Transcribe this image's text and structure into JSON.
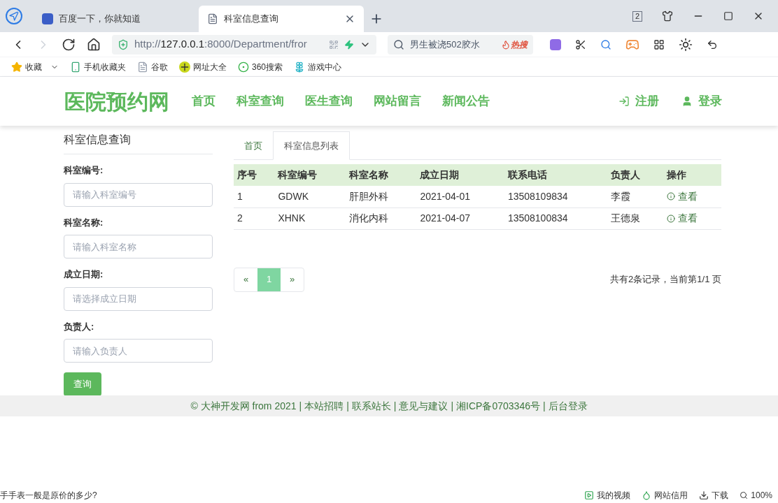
{
  "browser": {
    "tabs": [
      {
        "label": "百度一下，你就知道",
        "selected": false,
        "kind": "baidu"
      },
      {
        "label": "科室信息查询",
        "selected": true,
        "kind": "page"
      }
    ],
    "tab_count": "2",
    "address": {
      "host": "127.0.0.1",
      "prefix": "http://",
      "suffix": ":8000/Department/fror"
    },
    "search": {
      "value": "男生被浇502胶水",
      "hot": "热搜"
    },
    "bookmarks": [
      {
        "label": "收藏",
        "kind": "star"
      },
      {
        "label": "手机收藏夹",
        "kind": "phone"
      },
      {
        "label": "谷歌",
        "kind": "doc"
      },
      {
        "label": "网址大全",
        "kind": "plus"
      },
      {
        "label": "360搜索",
        "kind": "ring"
      },
      {
        "label": "游戏中心",
        "kind": "cross"
      }
    ]
  },
  "site": {
    "logo": "医院预约网",
    "nav": [
      "首页",
      "科室查询",
      "医生查询",
      "网站留言",
      "新闻公告"
    ],
    "auth": [
      {
        "label": "注册",
        "kind": "signin"
      },
      {
        "label": "登录",
        "kind": "user"
      }
    ]
  },
  "sidebar": {
    "title": "科室信息查询",
    "fields": [
      {
        "label": "科室编号:",
        "placeholder": "请输入科室编号"
      },
      {
        "label": "科室名称:",
        "placeholder": "请输入科室名称"
      },
      {
        "label": "成立日期:",
        "placeholder": "请选择成立日期"
      },
      {
        "label": "负责人:",
        "placeholder": "请输入负责人"
      }
    ],
    "button": "查询"
  },
  "tabs": [
    {
      "label": "首页",
      "selected": false
    },
    {
      "label": "科室信息列表",
      "selected": true
    }
  ],
  "table": {
    "columns": [
      "序号",
      "科室编号",
      "科室名称",
      "成立日期",
      "联系电话",
      "负责人",
      "操作"
    ],
    "rows": [
      [
        "1",
        "GDWK",
        "肝胆外科",
        "2021-04-01",
        "13508109834",
        "李霞",
        "查看"
      ],
      [
        "2",
        "XHNK",
        "消化内科",
        "2021-04-07",
        "13508100834",
        "王德泉",
        "查看"
      ]
    ]
  },
  "pagination": {
    "prev": "«",
    "pages": [
      {
        "label": "1",
        "selected": true
      }
    ],
    "next": "»",
    "summary": "共有2条记录，当前第1/1 页"
  },
  "footer": {
    "separator": "|",
    "links": [
      "© 大神开发网 from 2021",
      "本站招聘",
      "联系站长",
      "意见与建议",
      "湘ICP备0703346号",
      "后台登录"
    ]
  },
  "status_bar": {
    "left": "手手表一般是原价的多少?",
    "items": [
      "我的视频",
      "网站信用",
      "下载"
    ],
    "zoom": "100%"
  }
}
